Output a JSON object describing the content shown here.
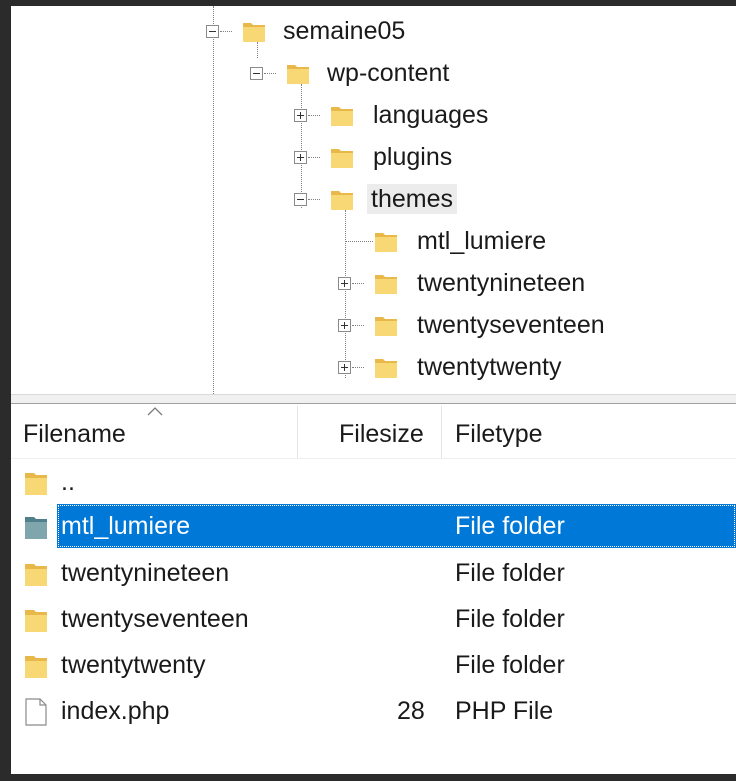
{
  "tree": {
    "nodes": [
      {
        "label": "semaine05",
        "expander": "minus",
        "icon": "folder-icon"
      },
      {
        "label": "wp-content",
        "expander": "minus",
        "icon": "folder-icon"
      },
      {
        "label": "languages",
        "expander": "plus",
        "icon": "folder-icon"
      },
      {
        "label": "plugins",
        "expander": "plus",
        "icon": "folder-icon"
      },
      {
        "label": "themes",
        "expander": "minus",
        "icon": "folder-icon"
      },
      {
        "label": "mtl_lumiere",
        "expander": "none",
        "icon": "folder-icon"
      },
      {
        "label": "twentynineteen",
        "expander": "plus",
        "icon": "folder-icon"
      },
      {
        "label": "twentyseventeen",
        "expander": "plus",
        "icon": "folder-icon"
      },
      {
        "label": "twentytwenty",
        "expander": "plus",
        "icon": "folder-icon"
      }
    ]
  },
  "file_list": {
    "columns": {
      "filename": "Filename",
      "filesize": "Filesize",
      "filetype": "Filetype"
    },
    "sort_column": "filename",
    "rows": [
      {
        "name": "..",
        "size": "",
        "type": "",
        "icon": "folder-icon"
      },
      {
        "name": "mtl_lumiere",
        "size": "",
        "type": "File folder",
        "icon": "folder-icon",
        "selected": true
      },
      {
        "name": "twentynineteen",
        "size": "",
        "type": "File folder",
        "icon": "folder-icon"
      },
      {
        "name": "twentyseventeen",
        "size": "",
        "type": "File folder",
        "icon": "folder-icon"
      },
      {
        "name": "twentytwenty",
        "size": "",
        "type": "File folder",
        "icon": "folder-icon"
      },
      {
        "name": "index.php",
        "size": "28",
        "type": "PHP File",
        "icon": "file-icon"
      }
    ]
  },
  "colors": {
    "selection": "#0078d7",
    "folder": "#f8d775",
    "folder_dark": "#e8b84a"
  }
}
